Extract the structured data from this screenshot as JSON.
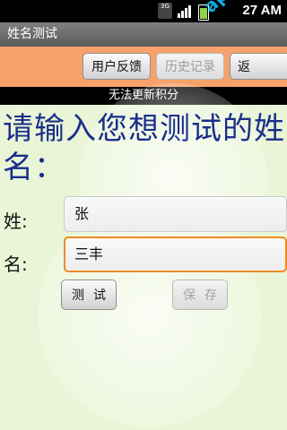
{
  "status_bar": {
    "network_label": "3G",
    "time": "27 AM"
  },
  "watermark": "apk8.com",
  "title_bar": {
    "title": "姓名测试"
  },
  "toolbar": {
    "feedback_label": "用户反馈",
    "history_label": "历史记录",
    "back_label": "返"
  },
  "notice": "无法更新积分",
  "form": {
    "prompt": "请输入您想测试的姓名：",
    "surname_label": "姓:",
    "surname_value": "张",
    "givenname_label": "名:",
    "givenname_value": "三丰"
  },
  "actions": {
    "test_label": "测试",
    "save_label": "保存"
  },
  "colors": {
    "toolbar_bg": "#f7a16b",
    "prompt_text": "#1a2f8a",
    "focus_border": "#f08a24",
    "watermark": "#0db4e6"
  }
}
